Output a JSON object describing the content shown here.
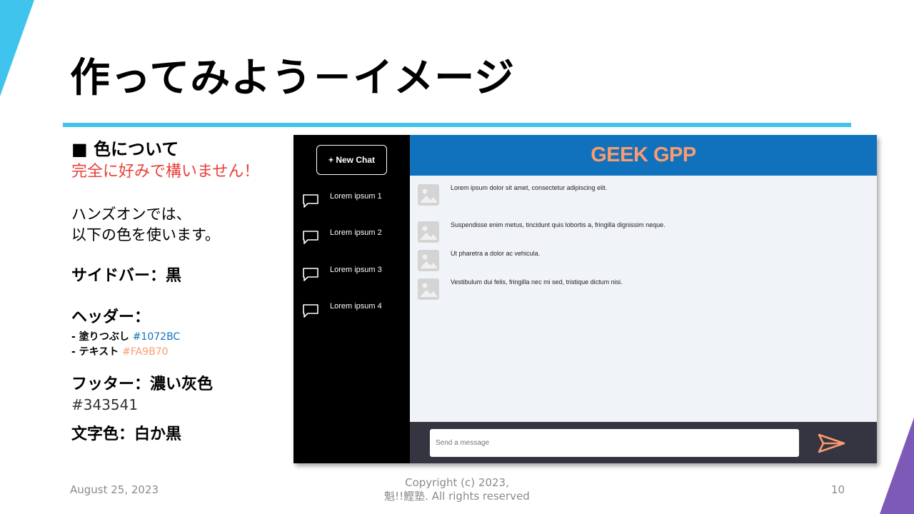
{
  "slide": {
    "title": "作ってみよう－イメージ",
    "date": "August 25, 2023",
    "copyright_line1": "Copyright (c) 2023,",
    "copyright_line2": "魁!!鰹塾. All rights reserved",
    "page_number": "10"
  },
  "left": {
    "section_heading": "■ 色について",
    "red_note": "完全に好みで構いません！",
    "intro_line1": "ハンズオンでは、",
    "intro_line2": "以下の色を使います。",
    "sidebar_line": "サイドバー：黒",
    "header_heading": "ヘッダー：",
    "fill_label": "- 塗りつぶし",
    "fill_code": "#1072BC",
    "text_label": "- テキスト",
    "text_code": "#FA9B70",
    "footer_heading": "フッター：濃い灰色",
    "footer_code": "#343541",
    "text_color_line": "文字色：白か黒"
  },
  "colors": {
    "accent_cyan": "#3fc4ee",
    "accent_purple": "#7d5ab7",
    "red_note": "#e8403a",
    "fill": "#1072bc",
    "text": "#fa9b70",
    "footer": "#343541"
  },
  "mock": {
    "new_chat_label": "+ New Chat",
    "sidebar_items": [
      "Lorem ipsum 1",
      "Lorem ipsum 2",
      "Lorem ipsum 3",
      "Lorem ipsum 4"
    ],
    "header_title": "GEEK GPP",
    "messages": [
      "Lorem ipsum dolor sit amet, consectetur adipiscing elit.",
      "Suspendisse enim metus, tincidunt quis lobortis a, fringilla dignissim neque.",
      "Ut pharetra a dolor ac vehicula.",
      "Vestibulum dui felis, fringilla nec mi sed, tristique dictum nisi."
    ],
    "input_placeholder": "Send a message",
    "icons": {
      "chat": "chat-bubble-icon",
      "avatar": "image-placeholder-icon",
      "send": "send-icon"
    }
  }
}
